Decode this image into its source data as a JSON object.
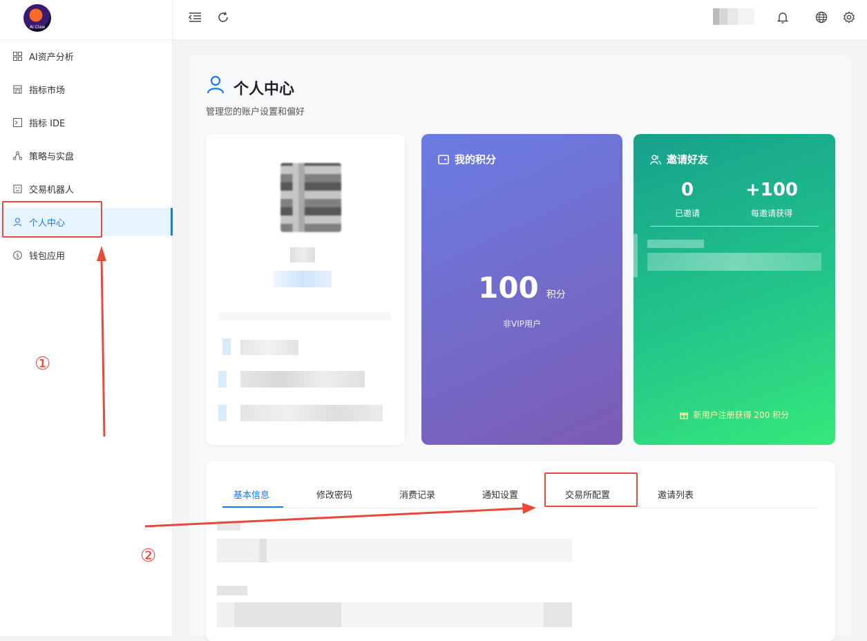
{
  "sidebar": {
    "logo_text": "AI Claw",
    "items": [
      {
        "label": "AI资产分析"
      },
      {
        "label": "指标市场"
      },
      {
        "label": "指标 IDE"
      },
      {
        "label": "策略与实盘"
      },
      {
        "label": "交易机器人"
      },
      {
        "label": "个人中心"
      },
      {
        "label": "钱包应用"
      }
    ]
  },
  "header": {
    "title": "个人中心",
    "subtitle": "管理您的账户设置和偏好"
  },
  "points_card": {
    "title": "我的积分",
    "value": "100",
    "unit": "积分",
    "status": "非VIP用户"
  },
  "invite_card": {
    "title": "邀请好友",
    "invited_count": "0",
    "invited_label": "已邀请",
    "reward_value": "+100",
    "reward_label": "每邀请获得",
    "bonus_note": "新用户注册获得 200 积分"
  },
  "tabs": [
    {
      "label": "基本信息"
    },
    {
      "label": "修改密码"
    },
    {
      "label": "消费记录"
    },
    {
      "label": "通知设置"
    },
    {
      "label": "交易所配置"
    },
    {
      "label": "邀请列表"
    }
  ],
  "annotations": {
    "step1": "①",
    "step2": "②"
  },
  "colors": {
    "accent": "#1677ff",
    "annotation": "#e9483a",
    "points_gradient_start": "#6a7de3",
    "points_gradient_end": "#7b5bb4",
    "invite_gradient_start": "#16a08c",
    "invite_gradient_end": "#37e87a"
  }
}
